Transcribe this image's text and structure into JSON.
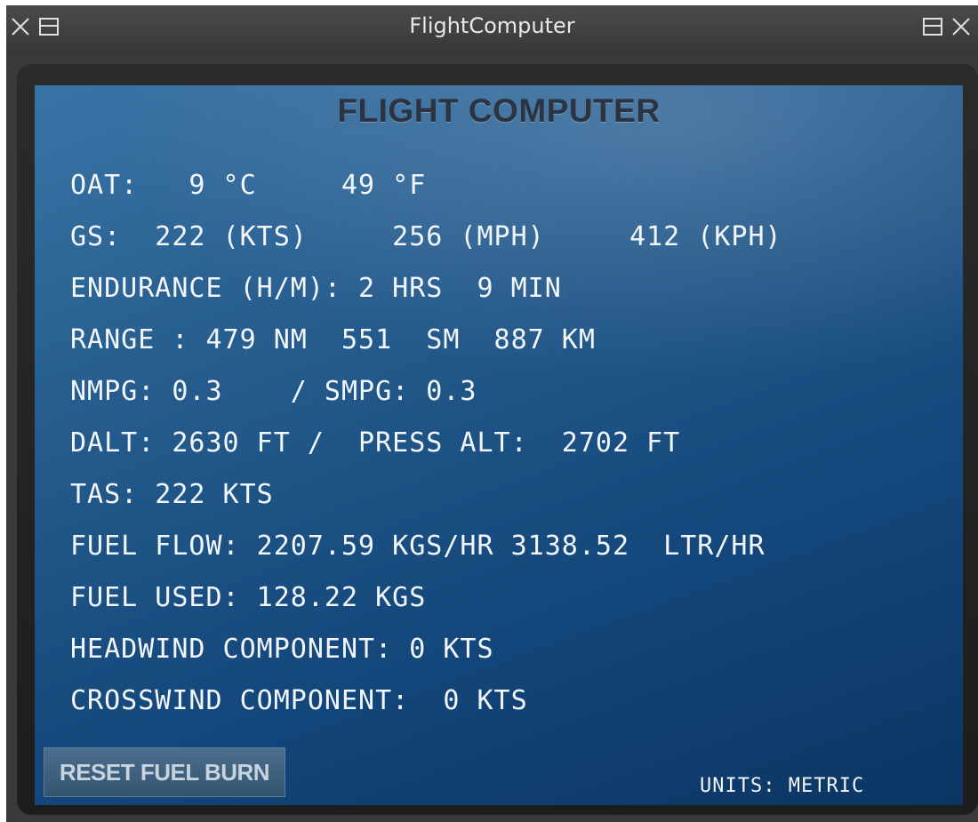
{
  "window": {
    "title": "FlightComputer"
  },
  "titlebar_icons": {
    "left": [
      "close-icon",
      "popout-icon"
    ],
    "right": [
      "popout-icon",
      "close-icon"
    ]
  },
  "panel": {
    "heading": "FLIGHT COMPUTER",
    "lines": [
      "OAT:   9 °C     49 °F",
      "GS:  222 (KTS)     256 (MPH)     412 (KPH)",
      "ENDURANCE (H/M): 2 HRS  9 MIN",
      "RANGE : 479 NM  551  SM  887 KM",
      "NMPG: 0.3    / SMPG: 0.3",
      "DALT: 2630 FT /  PRESS ALT:  2702 FT",
      "TAS: 222 KTS",
      "FUEL FLOW: 2207.59 KGS/HR 3138.52  LTR/HR",
      "FUEL USED: 128.22 KGS",
      "HEADWIND COMPONENT: 0 KTS",
      "CROSSWIND COMPONENT:  0 KTS"
    ],
    "reset_button_label": "RESET FUEL BURN",
    "units_label": "UNITS: METRIC"
  },
  "colors": {
    "screen_top": "#3a74a6",
    "screen_bottom": "#0b3563",
    "text": "#f2f6fa",
    "heading": "#2b3440"
  }
}
